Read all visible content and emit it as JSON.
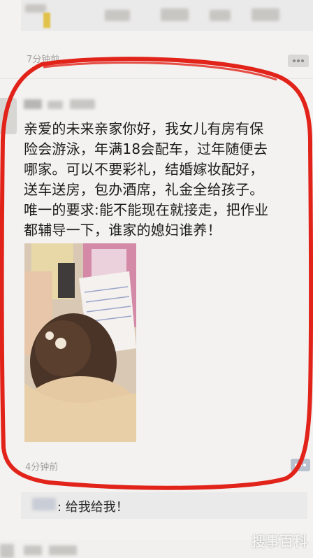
{
  "previous_post": {
    "time": "7分钟前"
  },
  "post": {
    "text": "亲爱的未来亲家你好，我女儿有房有保\n险会游泳，年满18会配车，过年随便去\n哪家。可以不要彩礼，结婚嫁妆配好，\n送车送房，包办酒席，礼金全给孩子。\n唯一的要求:能不能现在就接走，把作业\n都辅导一下，谁家的媳妇谁养！",
    "time": "4分钟前"
  },
  "comment": {
    "text": ": 给我给我！"
  },
  "watermark": "搜事百科",
  "colors": {
    "annotation_red": "#e2231a",
    "name_link": "#7a8aa8"
  }
}
